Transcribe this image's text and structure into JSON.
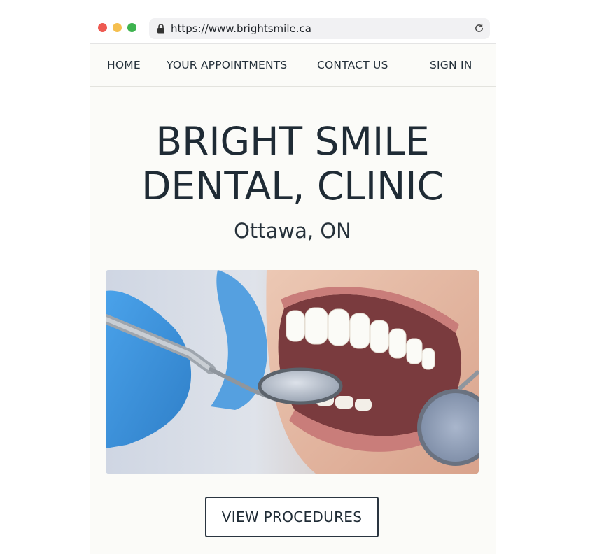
{
  "browser": {
    "url": "https://www.brightsmile.ca",
    "controls": [
      "close",
      "minimize",
      "maximize"
    ],
    "icons": {
      "lock": "lock-icon",
      "reload": "reload-icon"
    }
  },
  "nav": {
    "items": [
      {
        "label": "HOME"
      },
      {
        "label": "YOUR APPOINTMENTS"
      },
      {
        "label": "CONTACT US"
      },
      {
        "label": "SIGN IN"
      }
    ]
  },
  "hero": {
    "title_line1": "BRIGHT SMILE",
    "title_line2": "DENTAL, CLINIC",
    "subtitle": "Ottawa, ON",
    "cta_label": "VIEW PROCEDURES"
  },
  "colors": {
    "page_background": "#fbfbf8",
    "text": "#1f2b35",
    "close_dot": "#ee5a52",
    "minimize_dot": "#f5bf4f",
    "maximize_dot": "#3eb34f",
    "glove": "#3a8fd8"
  }
}
